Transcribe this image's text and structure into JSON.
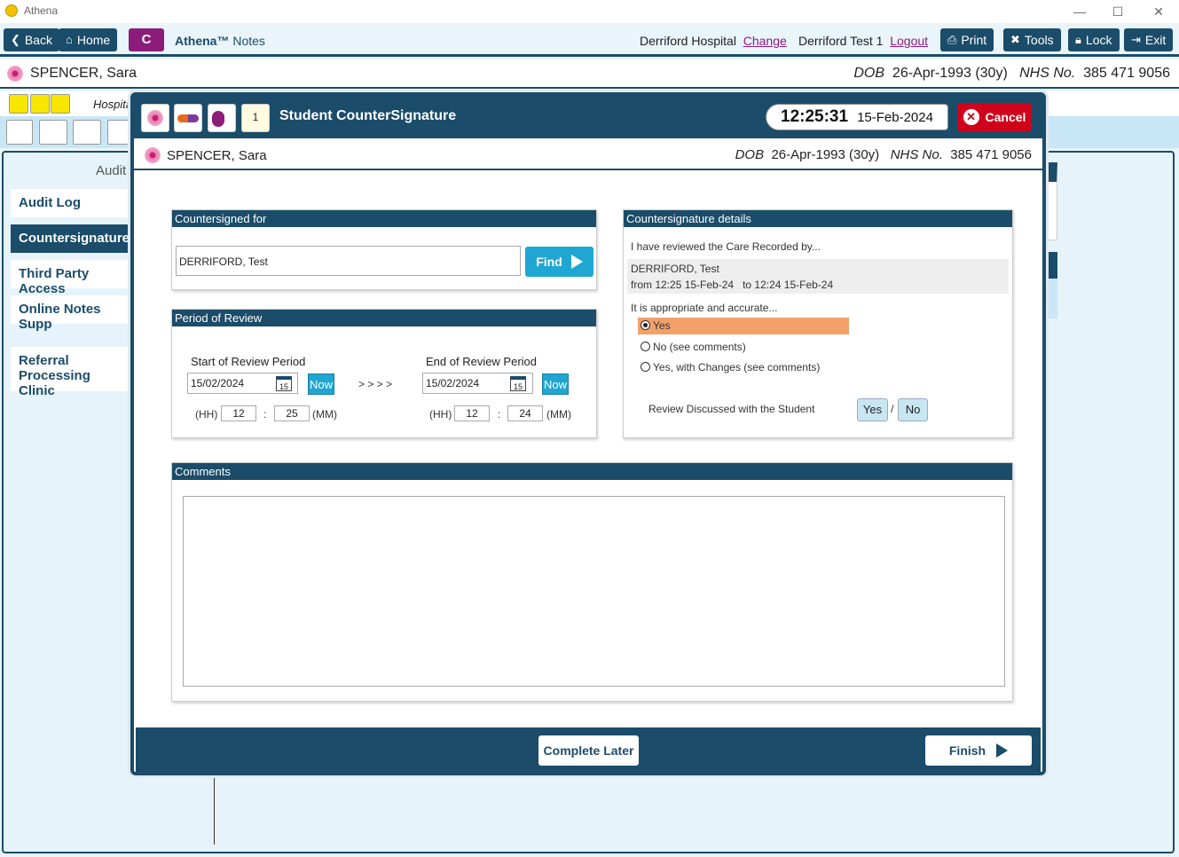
{
  "window": {
    "title": "Athena",
    "minimize": "—",
    "maximize": "☐",
    "close": "✕"
  },
  "toolbar": {
    "back": "Back",
    "home": "Home",
    "c": "C",
    "app_name": "Athena™",
    "app_section": "Notes",
    "hospital": "Derriford Hospital",
    "change": "Change",
    "user": "Derriford Test 1",
    "logout": "Logout",
    "print": "Print",
    "tools": "Tools",
    "lock": "Lock",
    "exit": "Exit"
  },
  "patient": {
    "name": "SPENCER, Sara",
    "dob_label": "DOB",
    "dob": "26-Apr-1993 (30y)",
    "nhs_label": "NHS No.",
    "nhs": "385 471 9056"
  },
  "background": {
    "sub_label": "Hospita",
    "audit_title": "Audit",
    "side_items": [
      "Audit Log",
      "Countersignature",
      "Third Party Access",
      "Online Notes Supp",
      "Referral Processing",
      "Clinic"
    ]
  },
  "modal": {
    "title": "Student CounterSignature",
    "time": "12:25:31",
    "date": "15-Feb-2024",
    "cancel": "Cancel",
    "countersigned_for": {
      "header": "Countersigned for",
      "value": "DERRIFORD, Test",
      "find": "Find"
    },
    "period": {
      "header": "Period of Review",
      "start_label": "Start of Review Period",
      "end_label": "End of Review Period",
      "start_date": "15/02/2024",
      "end_date": "15/02/2024",
      "cal_day": "15",
      "now": "Now",
      "arrows": "> > > >",
      "hh": "(HH)",
      "mm": "(MM)",
      "colon": ":",
      "start_hh": "12",
      "start_mm": "25",
      "end_hh": "12",
      "end_mm": "24"
    },
    "details": {
      "header": "Countersignature details",
      "reviewed_text": "I have reviewed the Care Recorded by...",
      "reviewer": "DERRIFORD, Test",
      "range": "from 12:25 15-Feb-24   to 12:24 15-Feb-24",
      "accurate_text": "It is appropriate and accurate...",
      "options": [
        "Yes",
        "No (see comments)",
        "Yes, with Changes (see comments)"
      ],
      "discussed_label": "Review Discussed with the Student",
      "yes": "Yes",
      "sep": "/",
      "no": "No"
    },
    "comments": {
      "header": "Comments",
      "value": ""
    },
    "footer": {
      "complete_later": "Complete Later",
      "finish": "Finish"
    }
  },
  "colors": {
    "brand": "#1b4c69",
    "accent": "#1fa6d2",
    "cancel": "#d0021b",
    "selected": "#f4a06a",
    "c_button": "#8c1c7a"
  }
}
